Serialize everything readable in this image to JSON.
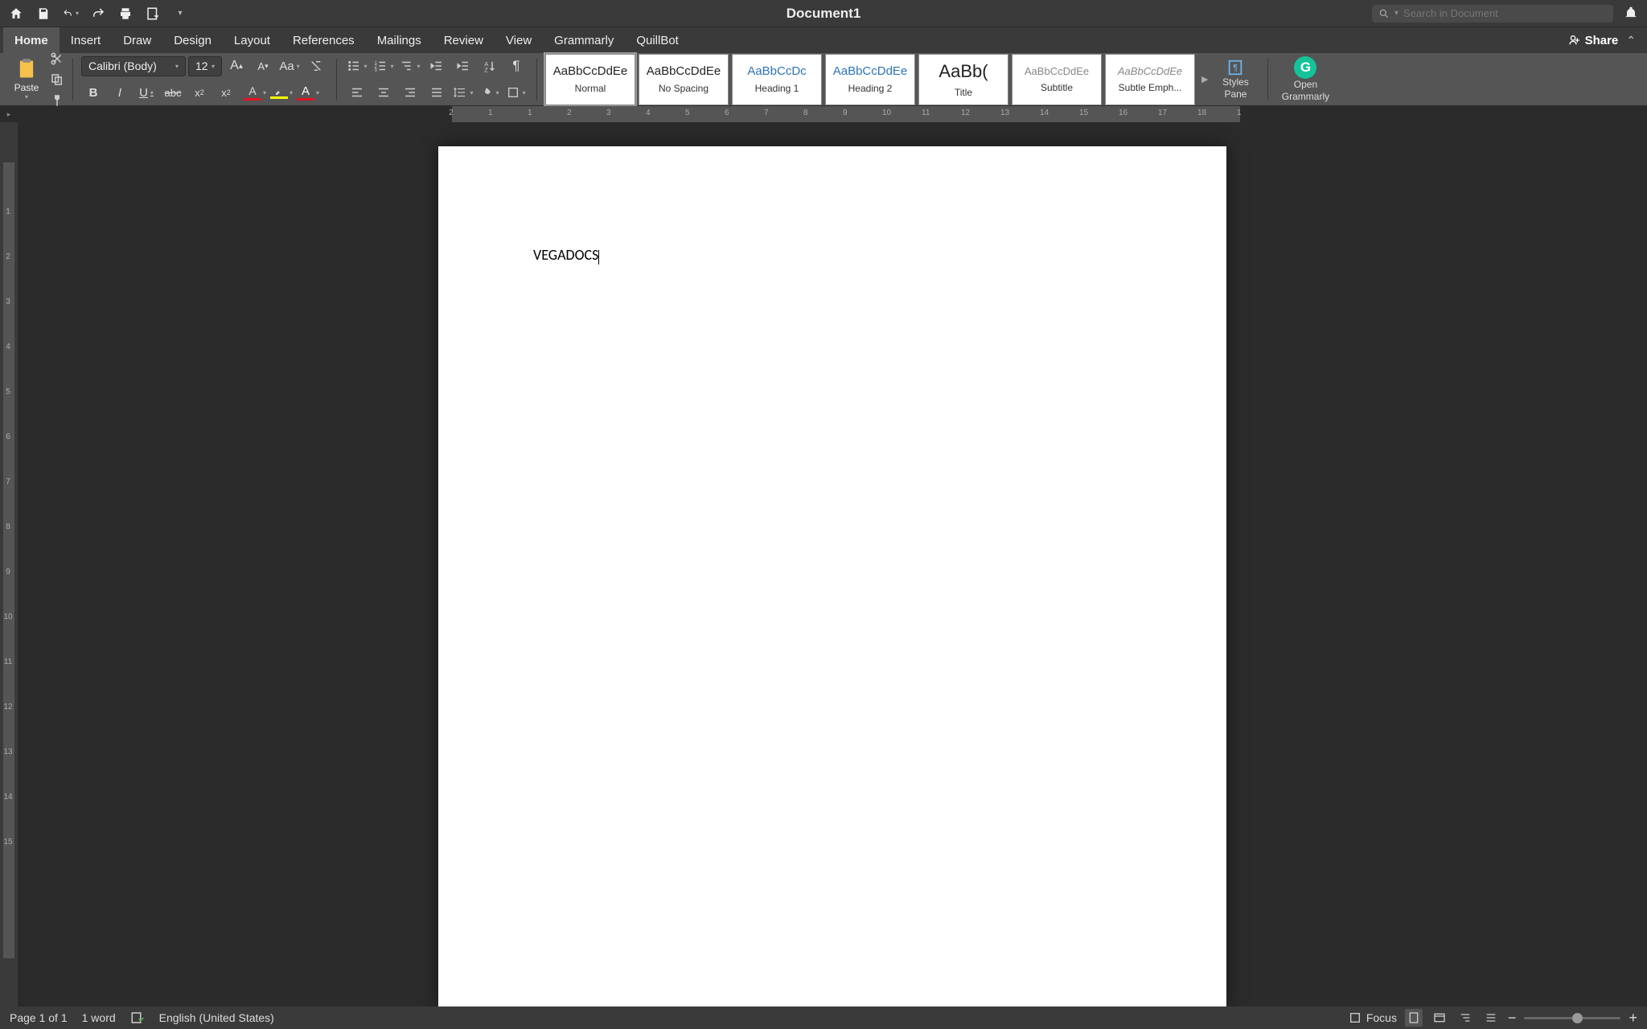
{
  "title": "Document1",
  "search": {
    "placeholder": "Search in Document"
  },
  "tabs": [
    "Home",
    "Insert",
    "Draw",
    "Design",
    "Layout",
    "References",
    "Mailings",
    "Review",
    "View",
    "Grammarly",
    "QuillBot"
  ],
  "active_tab": "Home",
  "share_label": "Share",
  "ribbon": {
    "paste_label": "Paste",
    "font_name": "Calibri (Body)",
    "font_size": "12",
    "styles": [
      {
        "preview": "AaBbCcDdEe",
        "name": "Normal",
        "cls": ""
      },
      {
        "preview": "AaBbCcDdEe",
        "name": "No Spacing",
        "cls": ""
      },
      {
        "preview": "AaBbCcDc",
        "name": "Heading 1",
        "cls": "heading"
      },
      {
        "preview": "AaBbCcDdEe",
        "name": "Heading 2",
        "cls": "heading"
      },
      {
        "preview": "AaBb(",
        "name": "Title",
        "cls": "title"
      },
      {
        "preview": "AaBbCcDdEe",
        "name": "Subtitle",
        "cls": "subtitle"
      },
      {
        "preview": "AaBbCcDdEe",
        "name": "Subtle Emph...",
        "cls": "emph"
      }
    ],
    "styles_pane": "Styles\nPane",
    "open_grammarly": "Open\nGrammarly"
  },
  "document": {
    "text": "VEGADOCS"
  },
  "status": {
    "page": "Page 1 of 1",
    "words": "1 word",
    "language": "English (United States)",
    "focus": "Focus"
  },
  "ruler_h_ticks": [
    "2",
    "1",
    "1",
    "2",
    "3",
    "4",
    "5",
    "6",
    "7",
    "8",
    "9",
    "10",
    "11",
    "12",
    "13",
    "14",
    "15",
    "16",
    "17",
    "18",
    "1"
  ],
  "ruler_v_ticks": [
    "1",
    "2",
    "3",
    "4",
    "5",
    "6",
    "7",
    "8",
    "9",
    "10",
    "11",
    "12",
    "13",
    "14",
    "15"
  ]
}
